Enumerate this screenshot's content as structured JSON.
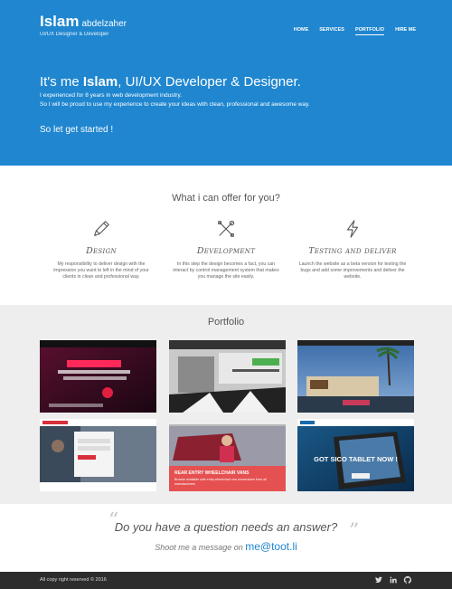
{
  "brand": {
    "first": "Islam",
    "last": "abdelzaher",
    "subtitle": "UI/UX Designer & Developer"
  },
  "nav": [
    {
      "label": "HOME",
      "active": false
    },
    {
      "label": "SERVICES",
      "active": false
    },
    {
      "label": "PORTFOLIO",
      "active": true
    },
    {
      "label": "HIRE ME",
      "active": false
    }
  ],
  "hero": {
    "title_pre": "It's me ",
    "title_name": "Islam",
    "title_post": ", UI/UX Developer & Designer.",
    "text": "I experienced for 8 years in web development industry.\nSo I will be proud to use my experience to create your ideas with clean, professional and awesome way.",
    "cta": "So let get started !"
  },
  "offer": {
    "title": "What i can offer for you?",
    "items": [
      {
        "icon": "pencil-icon",
        "name": "Design",
        "desc": "My responsibility to deliver design with the impression you want to left in the mind of your clients in clean and professional way."
      },
      {
        "icon": "tools-icon",
        "name": "Development",
        "desc": "In this step the design becomes a fact, you can interact by control management system that makes you manage the site easily."
      },
      {
        "icon": "lightning-icon",
        "name": "Testing and deliver",
        "desc": "Launch the website as a beta version for testing the bugs and add some improvements and deliver the website."
      }
    ]
  },
  "portfolio": {
    "title": "Portfolio",
    "items": [
      {
        "name": "arabic-ad-project"
      },
      {
        "name": "building-site-project"
      },
      {
        "name": "resort-project"
      },
      {
        "name": "wheelchair-login-project"
      },
      {
        "name": "rear-entry-vans-project",
        "caption_title": "REAR ENTRY WHEELCHAIR VANS",
        "caption_text": "Browse available side entry wheelchair van conversions from all manufacturers"
      },
      {
        "name": "sico-tablet-project",
        "banner": "GOT SICO TABLET NOW !"
      }
    ]
  },
  "contact": {
    "question": "Do you have a question needs an answer?",
    "shoot": "Shoot me a message on ",
    "email": "me@toot.li"
  },
  "footer": {
    "copy": "All copy right reserved © 2016"
  },
  "colors": {
    "primary": "#1f86cf",
    "footer": "#2d2d2d",
    "section": "#eeeeee"
  }
}
